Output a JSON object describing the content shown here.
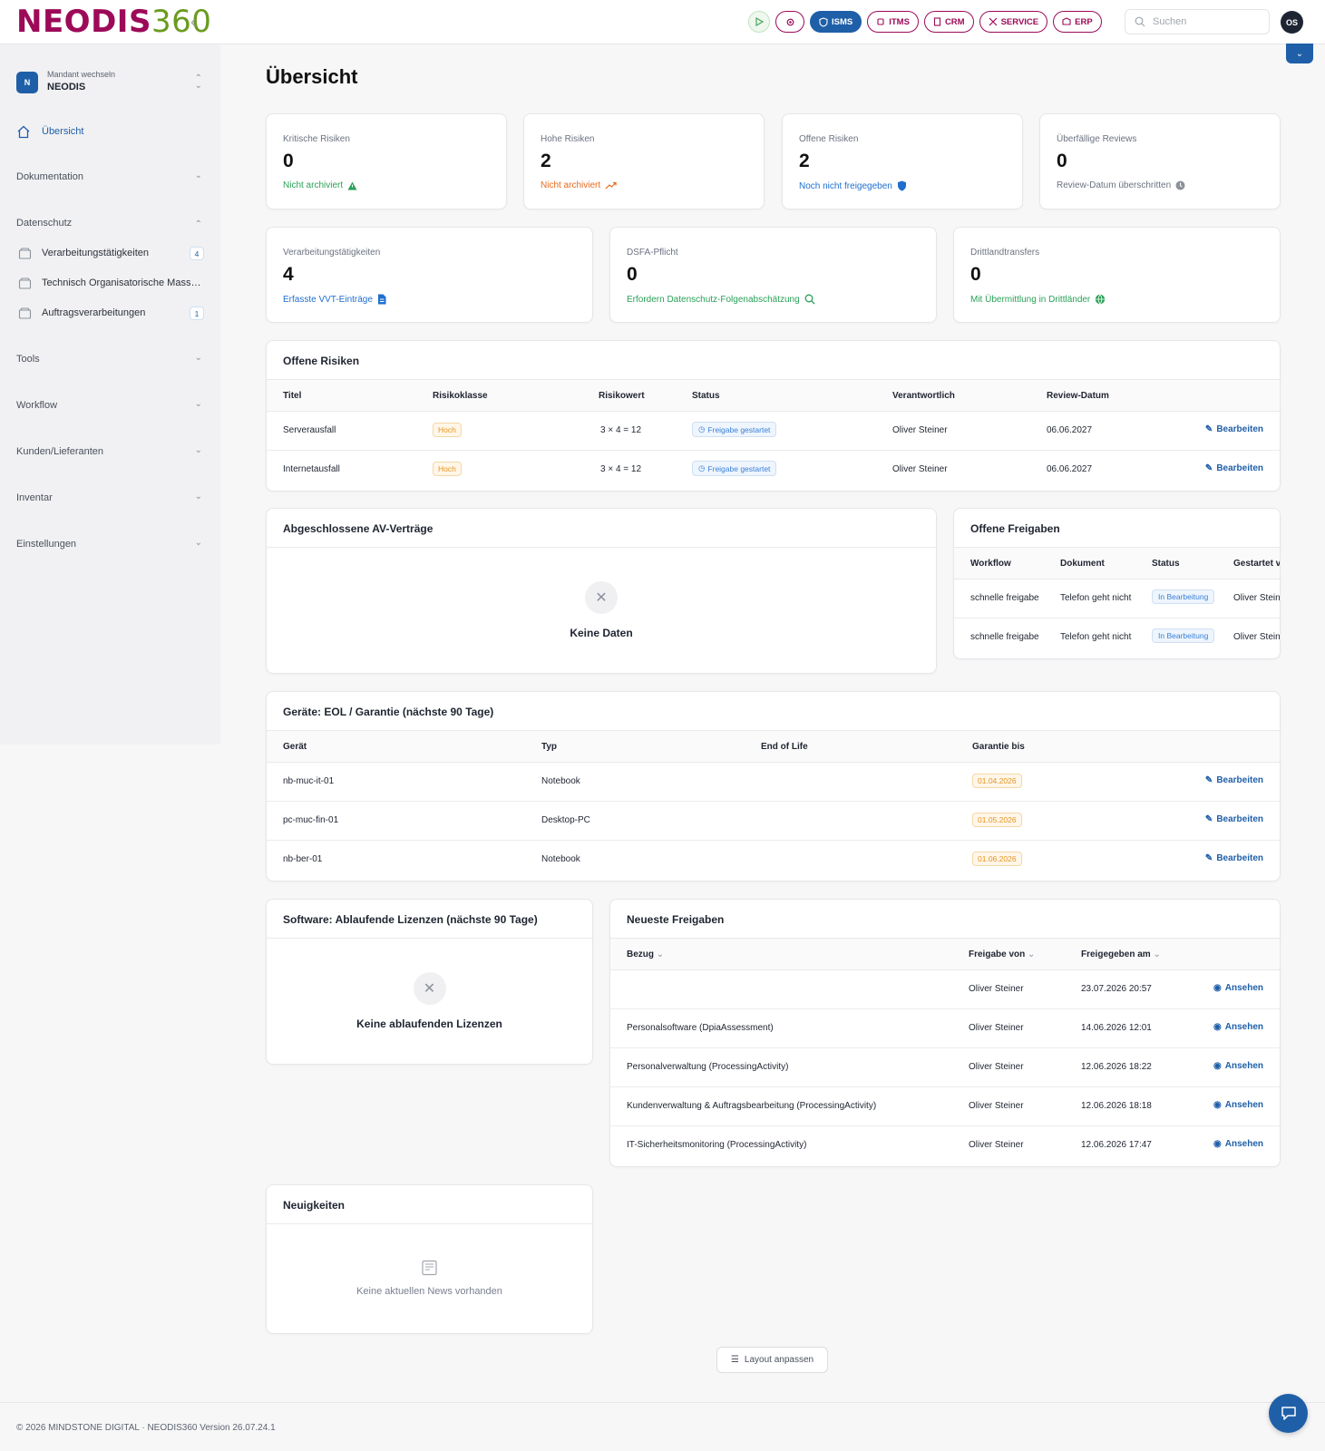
{
  "app": {
    "logo_a": "NEODIS",
    "logo_b": "360"
  },
  "header": {
    "modules": [
      "ISMS",
      "ITMS",
      "CRM",
      "SERVICE",
      "ERP"
    ],
    "active_module": "ISMS",
    "search_placeholder": "Suchen",
    "user_initials": "OS"
  },
  "sidebar": {
    "tenant_label": "Mandant wechseln",
    "tenant_name": "NEODIS",
    "tenant_badge": "N",
    "overview": "Übersicht",
    "dokumentation": "Dokumentation",
    "datenschutz": "Datenschutz",
    "sub": [
      {
        "label": "Verarbeitungstätigkeiten",
        "count": "4"
      },
      {
        "label": "Technisch Organisatorische Massnahmen",
        "count": ""
      },
      {
        "label": "Auftragsverarbeitungen",
        "count": "1"
      }
    ],
    "tools": "Tools",
    "workflow": "Workflow",
    "kunden": "Kunden/Lieferanten",
    "inventar": "Inventar",
    "einstellungen": "Einstellungen"
  },
  "page": {
    "title": "Übersicht"
  },
  "kpis_row1": [
    {
      "label": "Kritische Risiken",
      "value": "0",
      "sub": "Nicht archiviert"
    },
    {
      "label": "Hohe Risiken",
      "value": "2",
      "sub": "Nicht archiviert"
    },
    {
      "label": "Offene Risiken",
      "value": "2",
      "sub": "Noch nicht freigegeben"
    },
    {
      "label": "Überfällige Reviews",
      "value": "0",
      "sub": "Review-Datum überschritten"
    }
  ],
  "kpis_row2": [
    {
      "label": "Verarbeitungstätigkeiten",
      "value": "4",
      "sub": "Erfasste VVT-Einträge"
    },
    {
      "label": "DSFA-Pflicht",
      "value": "0",
      "sub": "Erfordern Datenschutz-Folgenabschätzung"
    },
    {
      "label": "Drittlandtransfers",
      "value": "0",
      "sub": "Mit Übermittlung in Drittländer"
    }
  ],
  "risks": {
    "title": "Offene Risiken",
    "headers": [
      "Titel",
      "Risikoklasse",
      "Risikowert",
      "Status",
      "Verantwortlich",
      "Review-Datum"
    ],
    "action": "Bearbeiten",
    "rows": [
      {
        "titel": "Serverausfall",
        "klasse": "Hoch",
        "wert": "3 × 4 = 12",
        "status": "Freigabe gestartet",
        "verantwortlich": "Oliver Steiner",
        "datum": "06.06.2027"
      },
      {
        "titel": "Internetausfall",
        "klasse": "Hoch",
        "wert": "3 × 4 = 12",
        "status": "Freigabe gestartet",
        "verantwortlich": "Oliver Steiner",
        "datum": "06.06.2027"
      }
    ]
  },
  "av": {
    "title": "Abgeschlossene AV-Verträge",
    "empty": "Keine Daten"
  },
  "approvals": {
    "title": "Offene Freigaben",
    "headers": [
      "Workflow",
      "Dokument",
      "Status",
      "Gestartet v"
    ],
    "rows": [
      {
        "workflow": "schnelle freigabe",
        "dokument": "Telefon geht nicht",
        "status": "In Bearbeitung",
        "gestartet": "Oliver Stein"
      },
      {
        "workflow": "schnelle freigabe",
        "dokument": "Telefon geht nicht",
        "status": "In Bearbeitung",
        "gestartet": "Oliver Stein"
      }
    ]
  },
  "devices": {
    "title": "Geräte: EOL / Garantie (nächste 90 Tage)",
    "headers": [
      "Gerät",
      "Typ",
      "End of Life",
      "Garantie bis"
    ],
    "action": "Bearbeiten",
    "rows": [
      {
        "geraet": "nb-muc-it-01",
        "typ": "Notebook",
        "eol": "",
        "garantie": "01.04.2026"
      },
      {
        "geraet": "pc-muc-fin-01",
        "typ": "Desktop-PC",
        "eol": "",
        "garantie": "01.05.2026"
      },
      {
        "geraet": "nb-ber-01",
        "typ": "Notebook",
        "eol": "",
        "garantie": "01.06.2026"
      }
    ]
  },
  "software": {
    "title": "Software: Ablaufende Lizenzen (nächste 90 Tage)",
    "empty": "Keine ablaufenden Lizenzen"
  },
  "latest": {
    "title": "Neueste Freigaben",
    "headers": [
      "Bezug",
      "Freigabe von",
      "Freigegeben am"
    ],
    "action": "Ansehen",
    "rows": [
      {
        "bezug": "",
        "von": "Oliver Steiner",
        "am": "23.07.2026 20:57"
      },
      {
        "bezug": "Personalsoftware (DpiaAssessment)",
        "von": "Oliver Steiner",
        "am": "14.06.2026 12:01"
      },
      {
        "bezug": "Personalverwaltung (ProcessingActivity)",
        "von": "Oliver Steiner",
        "am": "12.06.2026 18:22"
      },
      {
        "bezug": "Kundenverwaltung & Auftragsbearbeitung (ProcessingActivity)",
        "von": "Oliver Steiner",
        "am": "12.06.2026 18:18"
      },
      {
        "bezug": "IT-Sicherheitsmonitoring (ProcessingActivity)",
        "von": "Oliver Steiner",
        "am": "12.06.2026 17:47"
      }
    ]
  },
  "news": {
    "title": "Neuigkeiten",
    "empty": "Keine aktuellen News vorhanden"
  },
  "layout_button": "Layout anpassen",
  "footer": "© 2026 MINDSTONE DIGITAL · NEODIS360 Version 26.07.24.1",
  "colors": {
    "brand": "#9c0a58",
    "accent": "#1f5fa8",
    "brand_green": "#6b9b1e"
  }
}
